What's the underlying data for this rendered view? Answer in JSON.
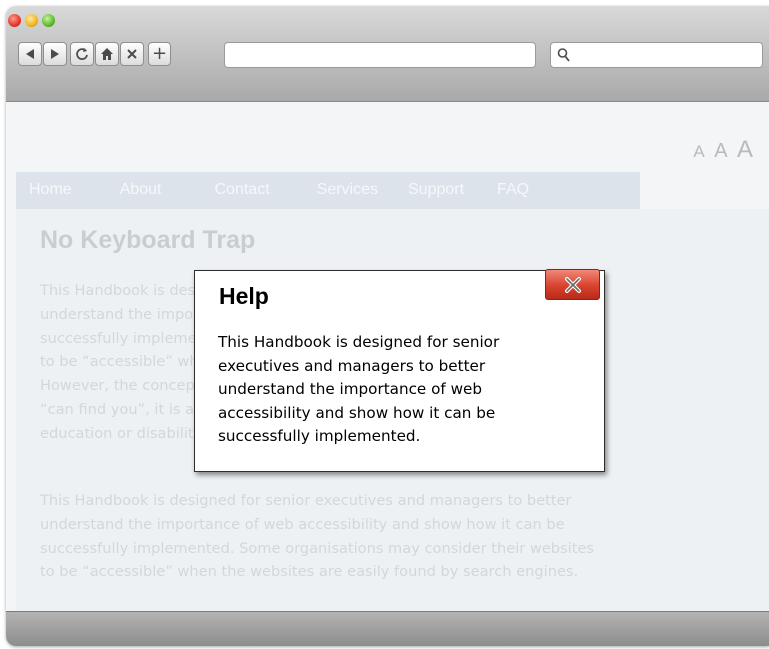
{
  "browser": {
    "new_tab_label": "+",
    "address_value": "",
    "search_value": ""
  },
  "page": {
    "text_size": [
      "A",
      "A",
      "A"
    ],
    "menu": [
      "Home",
      "About",
      "Contact",
      "Services",
      "Support",
      "FAQ"
    ],
    "title": "No Keyboard Trap",
    "paragraph1_lines": [
      "This Handbook is designed for senior executives and managers to better",
      "understand the importance of web accessibility and show how it can be",
      "successfully implemented. Some organisations may consider their websites",
      "to be “accessible” when the websites are easily found by search engines.",
      "However, the concept of web accessibility is about ensuring whether people",
      "“can find you”, it is about access for all regardless of disability, age, race,",
      "education or disability."
    ],
    "paragraph2_lines": [
      "This Handbook is designed for senior executives and managers to better",
      "understand the importance of web accessibility and show how it can be",
      "successfully implemented. Some organisations may consider their websites",
      "to be “accessible” when the websites are easily found by search engines."
    ]
  },
  "dialog": {
    "title": "Help",
    "body_lines": [
      "This Handbook is designed for senior",
      "executives and managers to better",
      "understand the importance of web",
      "accessibility and show how it can be",
      "successfully implemented."
    ]
  },
  "colors": {
    "menu_bg": "#dde3ea",
    "close_button": "#d9422e"
  }
}
